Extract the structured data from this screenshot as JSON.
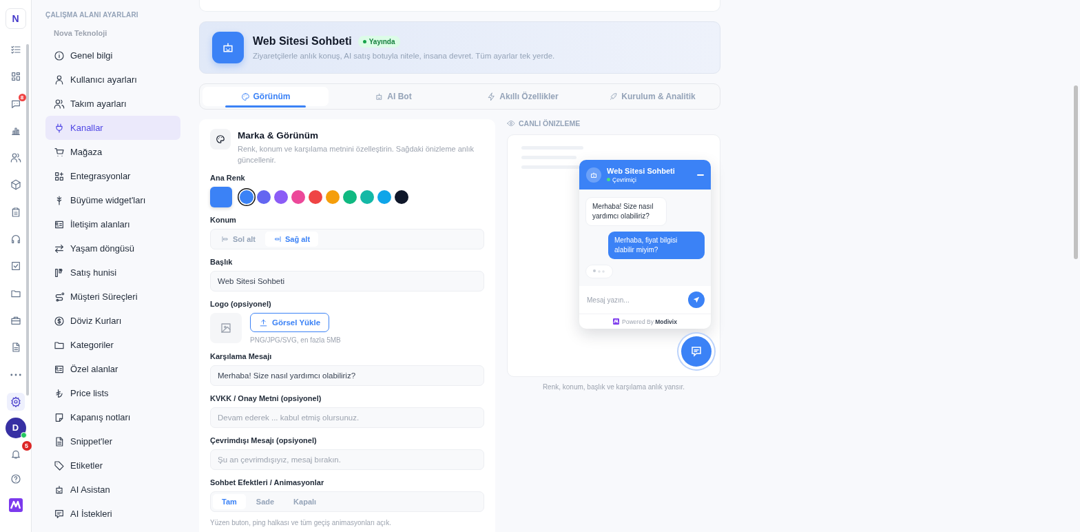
{
  "rail": {
    "logo": "N",
    "items": [
      {
        "selected": false
      },
      {
        "selected": false
      },
      {
        "selected": false,
        "badge": "8"
      },
      {
        "selected": false
      },
      {
        "selected": false
      },
      {
        "selected": false
      },
      {
        "selected": false
      },
      {
        "selected": false
      },
      {
        "selected": false
      },
      {
        "selected": false
      },
      {
        "selected": false
      },
      {
        "selected": false
      },
      {
        "selected": false
      },
      {
        "selected": true
      }
    ],
    "avatar": {
      "initial": "D",
      "online": true
    },
    "notifications": {
      "badge": "5"
    }
  },
  "sidebar": {
    "section_title": "ÇALIŞMA ALANI AYARLARI",
    "workspace": "Nova Teknoloji",
    "items": [
      {
        "label": "Genel bilgi",
        "selected": false
      },
      {
        "label": "Kullanıcı ayarları",
        "selected": false
      },
      {
        "label": "Takım ayarları",
        "selected": false
      },
      {
        "label": "Kanallar",
        "selected": true
      },
      {
        "label": "Mağaza",
        "selected": false
      },
      {
        "label": "Entegrasyonlar",
        "selected": false
      },
      {
        "label": "Büyüme widget'ları",
        "selected": false
      },
      {
        "label": "İletişim alanları",
        "selected": false
      },
      {
        "label": "Yaşam döngüsü",
        "selected": false
      },
      {
        "label": "Satış hunisi",
        "selected": false
      },
      {
        "label": "Müşteri Süreçleri",
        "selected": false
      },
      {
        "label": "Döviz Kurları",
        "selected": false
      },
      {
        "label": "Kategoriler",
        "selected": false
      },
      {
        "label": "Özel alanlar",
        "selected": false
      },
      {
        "label": "Price lists",
        "selected": false
      },
      {
        "label": "Kapanış notları",
        "selected": false
      },
      {
        "label": "Snippet'ler",
        "selected": false
      },
      {
        "label": "Etiketler",
        "selected": false
      },
      {
        "label": "AI Asistan",
        "selected": false
      },
      {
        "label": "AI İstekleri",
        "selected": false
      }
    ]
  },
  "header": {
    "title": "Web Sitesi Sohbeti",
    "status": "Yayında",
    "description": "Ziyaretçilerle anlık konuş, AI satış botuyla nitele, insana devret. Tüm ayarlar tek yerde."
  },
  "tabs": [
    {
      "label": "Görünüm",
      "selected": true
    },
    {
      "label": "AI Bot",
      "selected": false
    },
    {
      "label": "Akıllı Özellikler",
      "selected": false
    },
    {
      "label": "Kurulum & Analitik",
      "selected": false
    }
  ],
  "appearance": {
    "title": "Marka & Görünüm",
    "description": "Renk, konum ve karşılama metnini özelleştirin. Sağdaki önizleme anlık güncellenir.",
    "color_label": "Ana Renk",
    "swatches": [
      {
        "color": "#3b82f6",
        "selected": true
      },
      {
        "color": "#6366f1",
        "selected": false
      },
      {
        "color": "#8b5cf6",
        "selected": false
      },
      {
        "color": "#ec4899",
        "selected": false
      },
      {
        "color": "#ef4444",
        "selected": false
      },
      {
        "color": "#f59e0b",
        "selected": false
      },
      {
        "color": "#10b981",
        "selected": false
      },
      {
        "color": "#14b8a6",
        "selected": false
      },
      {
        "color": "#0ea5e9",
        "selected": false
      },
      {
        "color": "#0f172a",
        "selected": false
      }
    ],
    "position_label": "Konum",
    "positions": [
      {
        "label": "Sol alt",
        "selected": false
      },
      {
        "label": "Sağ alt",
        "selected": true
      }
    ],
    "title_label": "Başlık",
    "title_value": "Web Sitesi Sohbeti",
    "logo_label": "Logo (opsiyonel)",
    "upload_button": "Görsel Yükle",
    "logo_hint": "PNG/JPG/SVG, en fazla 5MB",
    "welcome_label": "Karşılama Mesajı",
    "welcome_value": "Merhaba! Size nasıl yardımcı olabiliriz?",
    "consent_label": "KVKK / Onay Metni (opsiyonel)",
    "consent_placeholder": "Devam ederek ... kabul etmiş olursunuz.",
    "offline_label": "Çevrimdışı Mesajı (opsiyonel)",
    "offline_placeholder": "Şu an çevrimdışıyız, mesaj bırakın.",
    "effects_label": "Sohbet Efektleri / Animasyonlar",
    "effects": [
      {
        "label": "Tam",
        "selected": true
      },
      {
        "label": "Sade",
        "selected": false
      },
      {
        "label": "Kapalı",
        "selected": false
      }
    ],
    "effects_hint": "Yüzen buton, ping halkası ve tüm geçiş animasyonları açık."
  },
  "preview": {
    "label": "CANLI ÖNIZLEME",
    "widget": {
      "title": "Web Sitesi Sohbeti",
      "status": "Çevrimiçi",
      "messages": [
        {
          "kind": "bot",
          "text": "Merhaba! Size nasıl yardımcı olabiliriz?"
        },
        {
          "kind": "user",
          "text": "Merhaba, fiyat bilgisi alabilir miyim?"
        }
      ],
      "typing": true,
      "input_placeholder": "Mesaj yazın...",
      "powered_by": "Powered By",
      "brand": "Modivix"
    },
    "caption": "Renk, konum, başlık ve karşılama anlık yansır."
  }
}
